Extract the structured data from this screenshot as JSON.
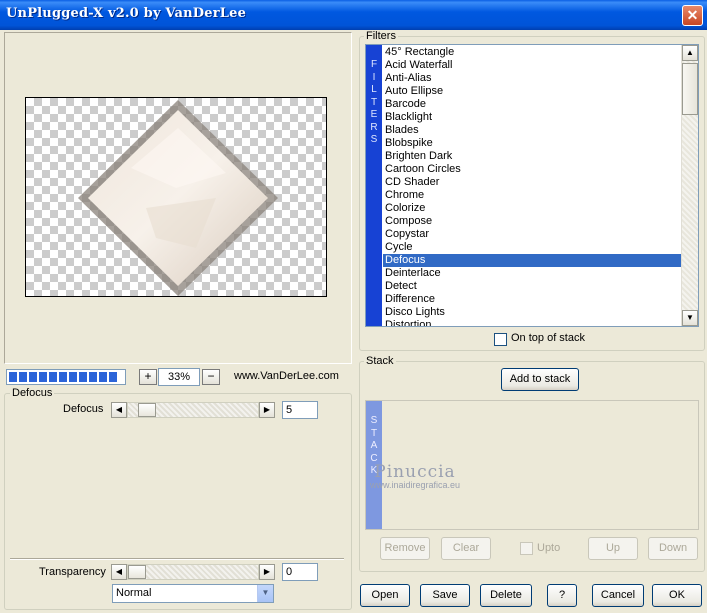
{
  "window": {
    "title": "UnPlugged-X v2.0 by VanDerLee",
    "close_glyph": "✕"
  },
  "preview": {
    "progress_segments": 11,
    "zoom_value": "33%",
    "zoom_in": "+",
    "zoom_out": "−",
    "website": "www.VanDerLee.com"
  },
  "defocus_panel": {
    "title": "Defocus",
    "param_label": "Defocus",
    "param_value": "5",
    "transparency_label": "Transparency",
    "transparency_value": "0",
    "blend_mode": "Normal"
  },
  "filters": {
    "title": "Filters",
    "vertical_label": [
      "F",
      "I",
      "L",
      "T",
      "E",
      "R",
      "S"
    ],
    "selected_index": 16,
    "items": [
      "45° Rectangle",
      "Acid Waterfall",
      "Anti-Alias",
      "Auto Ellipse",
      "Barcode",
      "Blacklight",
      "Blades",
      "Blobspike",
      "Brighten Dark",
      "Cartoon Circles",
      "CD Shader",
      "Chrome",
      "Colorize",
      "Compose",
      "Copystar",
      "Cycle",
      "Defocus",
      "Deinterlace",
      "Detect",
      "Difference",
      "Disco Lights",
      "Distortion"
    ],
    "on_top_label": "On top of stack"
  },
  "stack": {
    "title": "Stack",
    "vertical_label": [
      "S",
      "T",
      "A",
      "C",
      "K"
    ],
    "add_label": "Add to stack",
    "remove_label": "Remove",
    "clear_label": "Clear",
    "upto_label": "Upto",
    "up_label": "Up",
    "down_label": "Down"
  },
  "footer": {
    "open": "Open",
    "save": "Save",
    "delete": "Delete",
    "help": "?",
    "cancel": "Cancel",
    "ok": "OK"
  },
  "watermark": {
    "line1": "Pinuccia",
    "line2": "www.inaidiregrafica.eu"
  }
}
